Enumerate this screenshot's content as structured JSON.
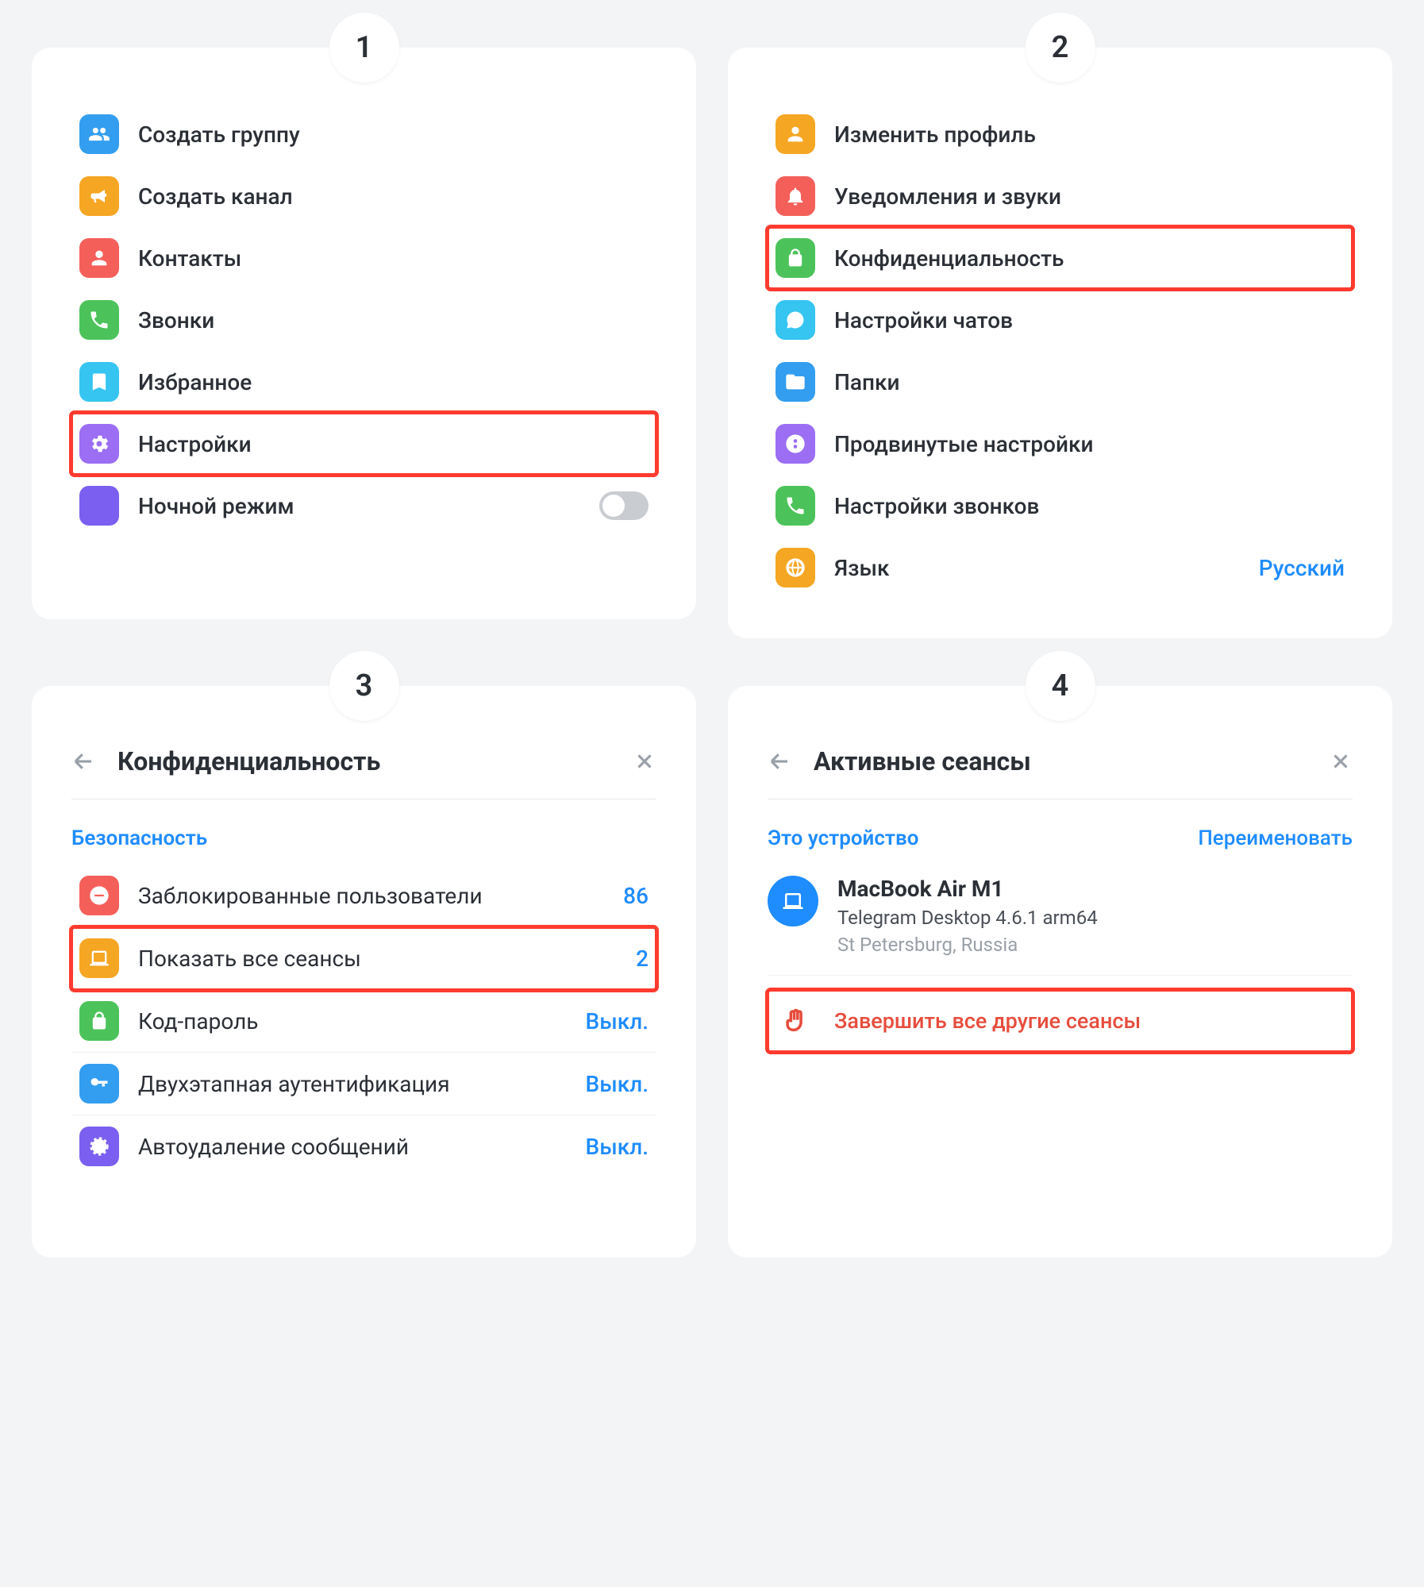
{
  "steps": {
    "s1": "1",
    "s2": "2",
    "s3": "3",
    "s4": "4"
  },
  "panel1": {
    "items": [
      {
        "label": "Создать группу"
      },
      {
        "label": "Создать канал"
      },
      {
        "label": "Контакты"
      },
      {
        "label": "Звонки"
      },
      {
        "label": "Избранное"
      },
      {
        "label": "Настройки"
      },
      {
        "label": "Ночной режим"
      }
    ]
  },
  "panel2": {
    "items": [
      {
        "label": "Изменить профиль"
      },
      {
        "label": "Уведомления и звуки"
      },
      {
        "label": "Конфиденциальность"
      },
      {
        "label": "Настройки чатов"
      },
      {
        "label": "Папки"
      },
      {
        "label": "Продвинутые настройки"
      },
      {
        "label": "Настройки звонков"
      },
      {
        "label": "Язык",
        "value": "Русский"
      }
    ]
  },
  "panel3": {
    "title": "Конфиденциальность",
    "section": "Безопасность",
    "items": [
      {
        "label": "Заблокированные пользователи",
        "value": "86"
      },
      {
        "label": "Показать все сеансы",
        "value": "2"
      },
      {
        "label": "Код-пароль",
        "value": "Выкл."
      },
      {
        "label": "Двухэтапная аутентификация",
        "value": "Выкл."
      },
      {
        "label": "Автоудаление сообщений",
        "value": "Выкл."
      }
    ]
  },
  "panel4": {
    "title": "Активные сеансы",
    "section": "Это устройство",
    "rename": "Переименовать",
    "device": {
      "name": "MacBook Air M1",
      "sub": "Telegram Desktop 4.6.1 arm64",
      "loc": "St Petersburg, Russia"
    },
    "terminate": "Завершить все другие сеансы"
  }
}
